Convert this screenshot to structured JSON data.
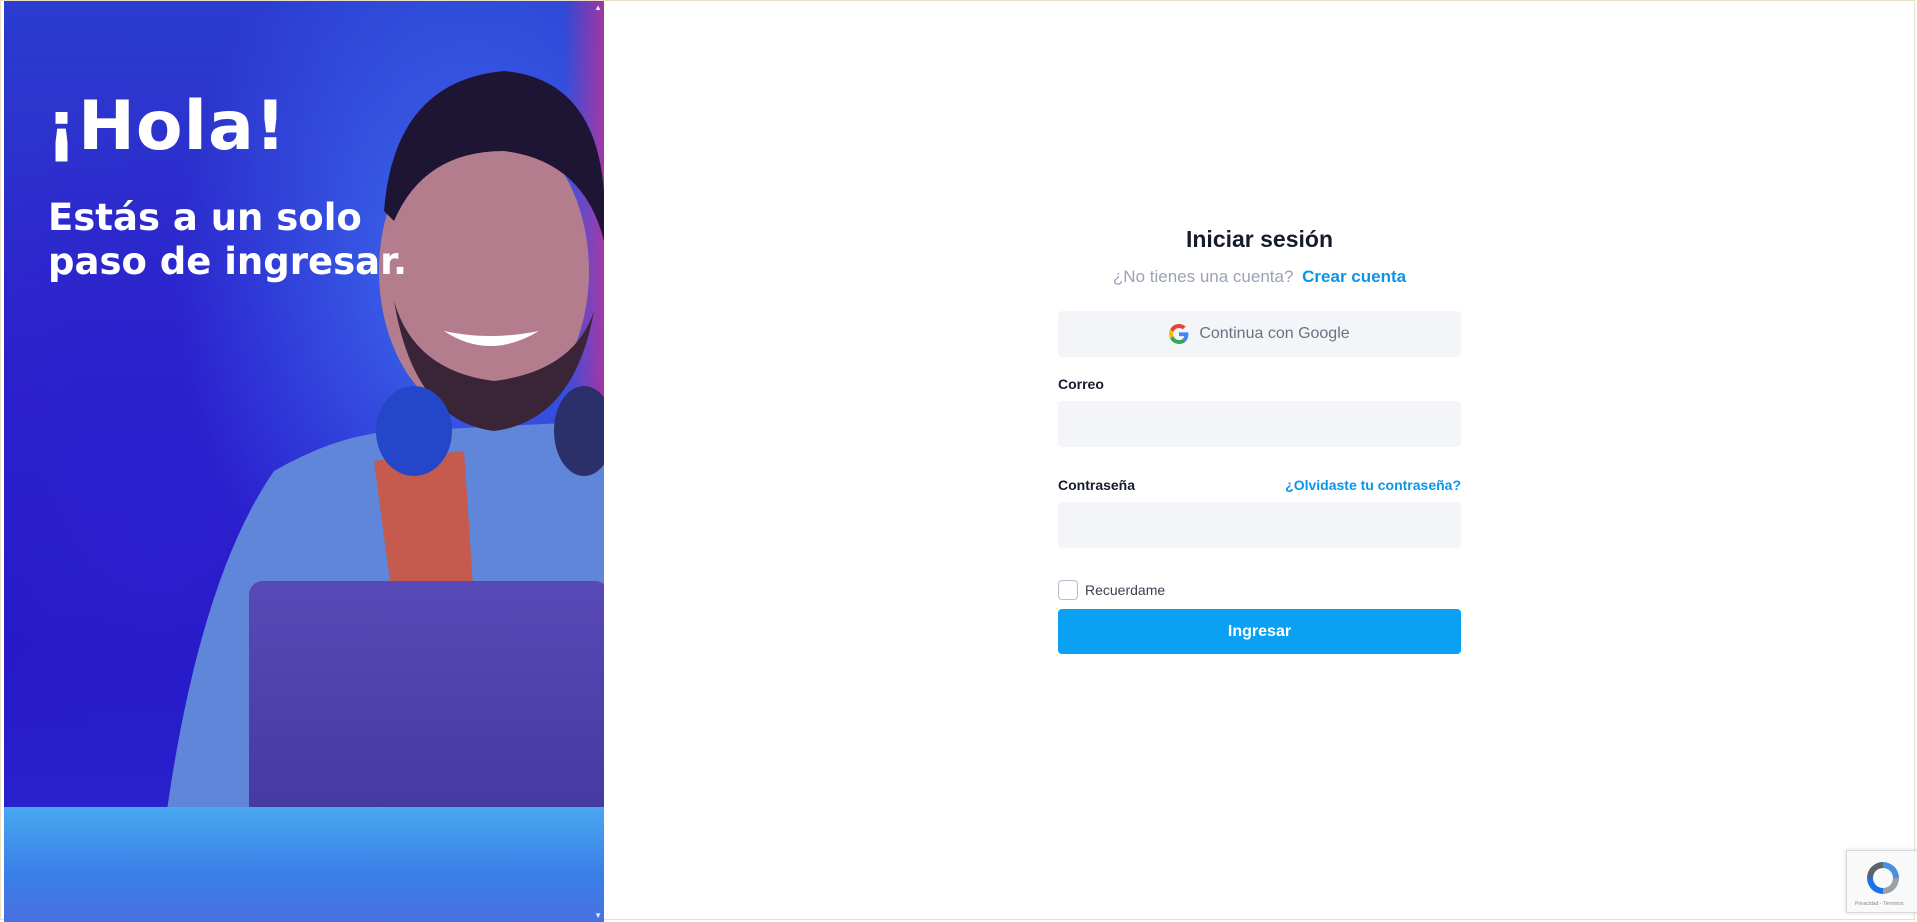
{
  "hero": {
    "greeting": "¡Hola!",
    "tagline": "Estás a un solo paso de ingresar."
  },
  "login": {
    "title": "Iniciar sesión",
    "no_account": "¿No tienes una cuenta?",
    "create_account": "Crear cuenta",
    "google_button": "Continua con Google",
    "email_label": "Correo",
    "email_value": "",
    "password_label": "Contraseña",
    "password_value": "",
    "forgot_password": "¿Olvidaste tu contraseña?",
    "remember_me": "Recuerdame",
    "submit": "Ingresar"
  },
  "recaptcha": {
    "terms": "Privacidad - Términos"
  },
  "colors": {
    "accent": "#0aa1f2",
    "link": "#0a96e8",
    "field_bg": "#f3f5f8",
    "hero_blue": "#2d24c9"
  },
  "icons": [
    "google-icon",
    "checkbox-icon",
    "recaptcha-icon",
    "scroll-up-icon",
    "scroll-down-icon"
  ]
}
